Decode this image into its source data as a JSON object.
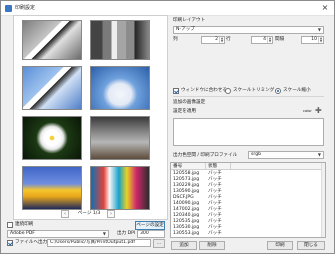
{
  "window": {
    "title": "印刷設定",
    "close_glyph": "×"
  },
  "preview": {
    "pager": {
      "prev": "‹",
      "next": "›",
      "label": "ページ 1/3"
    }
  },
  "bottom_left": {
    "continuous_print_label": "連続印刷",
    "printer_value": "Adobe PDF",
    "page_setup_button": "ページの設定",
    "dpi_label": "出力 DPI",
    "dpi_value": "300",
    "file_output_label": "ファイルへ出力",
    "file_path_value": "C:/Users/Public/写真/PrintOutput1.pdf",
    "browse_button": "..."
  },
  "layout": {
    "section_label": "印刷レイアウト",
    "layout_value": "N-アップ",
    "columns_label": "列",
    "columns_value": "2",
    "rows_label": "行",
    "rows_value": "4",
    "spacing_label": "間隔",
    "spacing_value": "10"
  },
  "fit": {
    "fit_window_label": "ウィンドウに合わせる",
    "scale_trim_label": "スケールトリミング",
    "scale_shrink_label": "スケール縮小"
  },
  "rows_section": {
    "label": "追加の画像設定",
    "apply_label": "設定を適用",
    "color_label": "color"
  },
  "color_profile": {
    "label": "出力色空間 / 印刷プロファイル",
    "value": "srgb"
  },
  "table": {
    "columns": [
      "番号",
      "状態"
    ],
    "rows": [
      [
        "120558.jpg",
        "バッチ"
      ],
      [
        "120573.jpg",
        "バッチ"
      ],
      [
        "130229.jpg",
        "バッチ"
      ],
      [
        "130590.jpg",
        "バッチ"
      ],
      [
        "DSCF.JPG",
        "バッチ"
      ],
      [
        "140090.jpg",
        "バッチ"
      ],
      [
        "147002.jpg",
        "バッチ"
      ],
      [
        "120340.jpg",
        "バッチ"
      ],
      [
        "120535.jpg",
        "バッチ"
      ],
      [
        "130530.jpg",
        "バッチ"
      ],
      [
        "130553.jpg",
        "バッチ"
      ]
    ]
  },
  "footer": {
    "add_button": "追加",
    "remove_button": "削除",
    "print_button": "印刷",
    "close_button": "閉じる"
  }
}
